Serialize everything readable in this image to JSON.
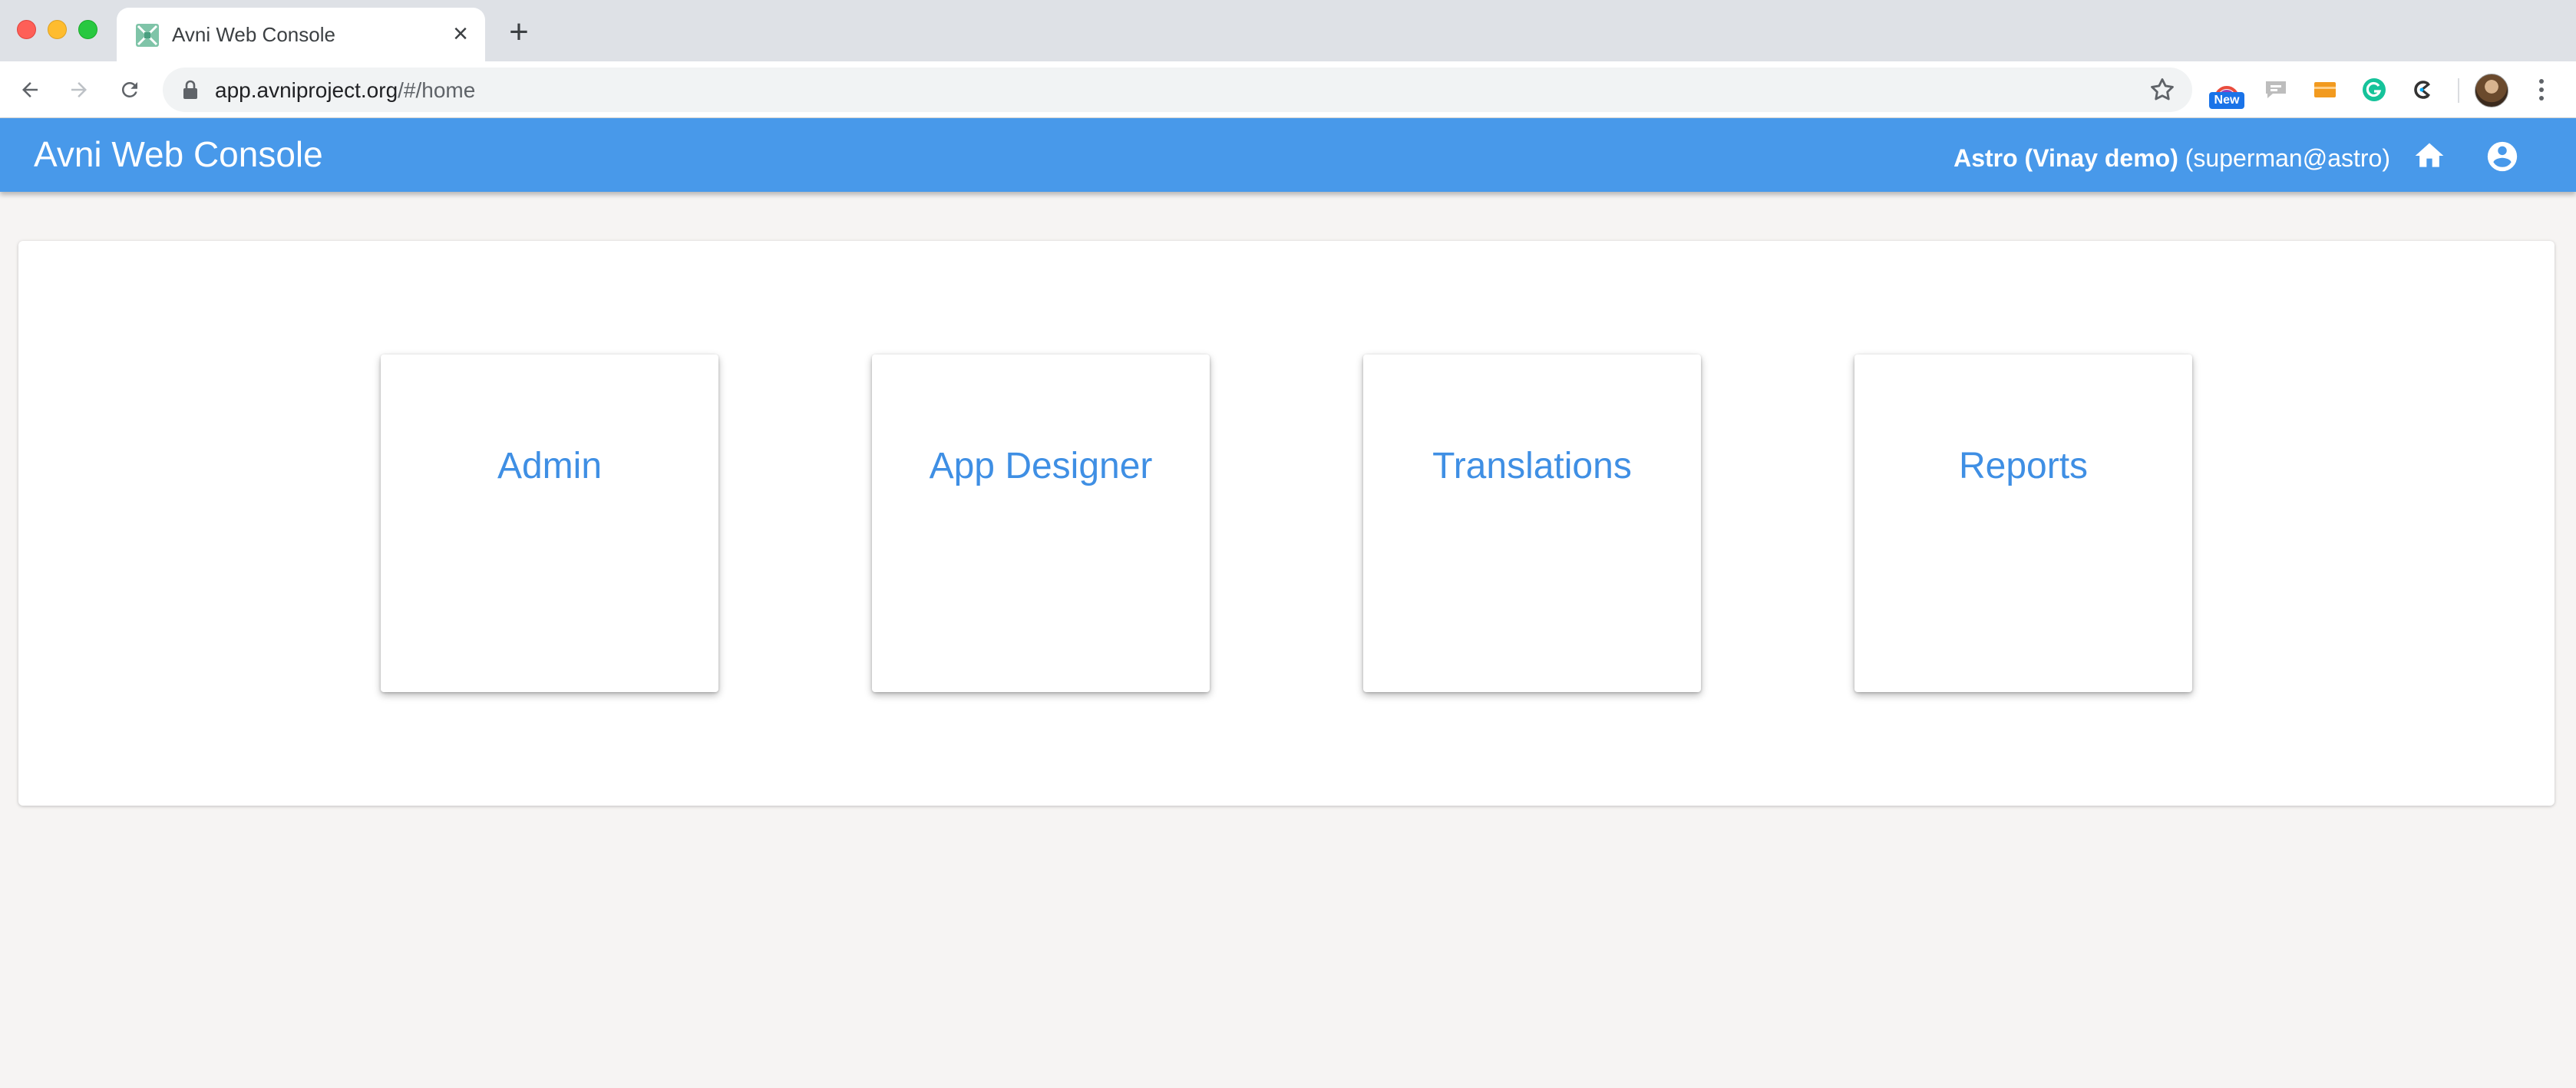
{
  "browser": {
    "tab": {
      "title": "Avni Web Console",
      "close_glyph": "×",
      "favicon": "avni-favicon-icon"
    },
    "new_tab_glyph": "+",
    "address": {
      "host": "app.avniproject.org",
      "path": "/#/home"
    },
    "extensions": [
      "rainbow-extension-icon",
      "chat-extension-icon",
      "folder-extension-icon",
      "grammarly-icon",
      "clockify-icon"
    ],
    "extension_badge": "New",
    "colors": {
      "tabstrip": "#dee1e6",
      "toolbar": "#ffffff",
      "omnibox": "#f1f3f4"
    }
  },
  "app": {
    "title": "Avni Web Console",
    "user": {
      "org": "Astro (Vinay demo)",
      "email": "(superman@astro)"
    },
    "icons": {
      "home": "home-icon",
      "account": "account-circle-icon"
    },
    "colors": {
      "appbar": "#4899ea",
      "card_label": "#3f8fe4",
      "background": "#f6f4f3"
    }
  },
  "home": {
    "cards": [
      {
        "label": "Admin"
      },
      {
        "label": "App Designer"
      },
      {
        "label": "Translations"
      },
      {
        "label": "Reports"
      }
    ]
  }
}
